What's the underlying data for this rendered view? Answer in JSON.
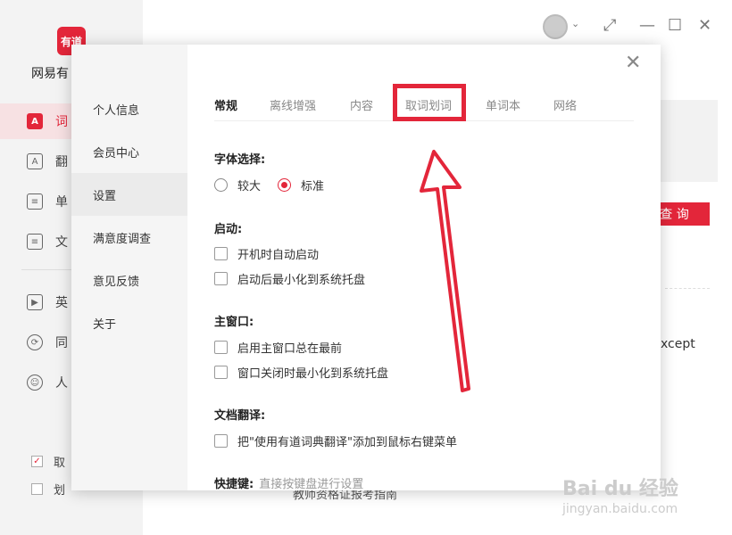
{
  "app": {
    "logo_text": "有道",
    "name": "网易有",
    "nav": [
      {
        "label": "词",
        "icon": "dictionary-icon"
      },
      {
        "label": "翻",
        "icon": "translate-icon"
      },
      {
        "label": "单",
        "icon": "wordbook-icon"
      },
      {
        "label": "文",
        "icon": "document-icon"
      },
      {
        "label": "英",
        "icon": "video-icon"
      },
      {
        "label": "同",
        "icon": "sync-icon"
      },
      {
        "label": "人",
        "icon": "human-icon"
      }
    ],
    "bottom_checks": [
      {
        "label": "取",
        "checked": true
      },
      {
        "label": "划",
        "checked": false
      }
    ],
    "query_button": "查 询",
    "bg_text": "xcept",
    "bg_bottom_text": "教师资格证报考指南"
  },
  "dialog": {
    "sidebar": [
      "个人信息",
      "会员中心",
      "设置",
      "满意度调查",
      "意见反馈",
      "关于"
    ],
    "active_sidebar": 2,
    "tabs": [
      "常规",
      "离线增强",
      "内容",
      "取词划词",
      "单词本",
      "网络"
    ],
    "active_tab": 0,
    "highlight_color": "#e3263a",
    "font_section": {
      "title": "字体选择:",
      "options": [
        "较大",
        "标准"
      ],
      "selected": 1
    },
    "startup_section": {
      "title": "启动:",
      "options": [
        "开机时自动启动",
        "启动后最小化到系统托盘"
      ]
    },
    "main_window_section": {
      "title": "主窗口:",
      "options": [
        "启用主窗口总在最前",
        "窗口关闭时最小化到系统托盘"
      ]
    },
    "doc_translate_section": {
      "title": "文档翻译:",
      "options": [
        "把\"使用有道词典翻译\"添加到鼠标右键菜单"
      ]
    },
    "shortcut_section": {
      "title": "快捷键:",
      "hint": "直接按键盘进行设置"
    }
  },
  "watermark": {
    "text": "Bai du 经验",
    "sub": "jingyan.baidu.com"
  }
}
